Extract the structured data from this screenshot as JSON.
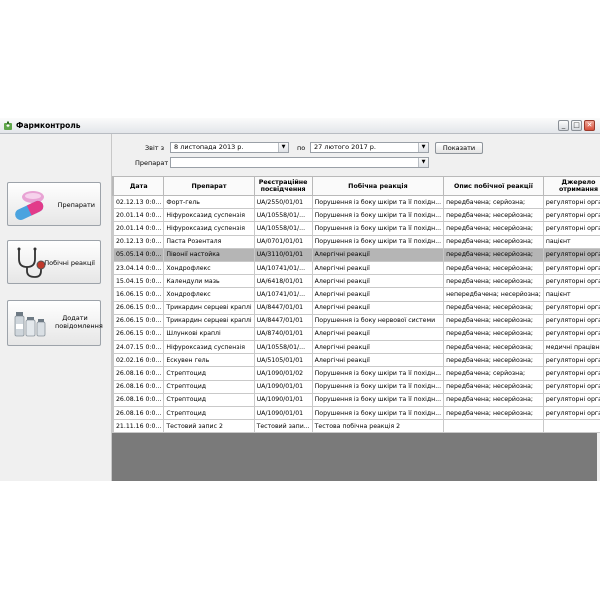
{
  "window": {
    "title": "Фармконтроль",
    "controls": {
      "minimize": "_",
      "maximize": "□",
      "close": "✕"
    }
  },
  "sidebar": {
    "items": [
      {
        "label": "Препарати",
        "icon": "pills-icon"
      },
      {
        "label": "Побічні реакції",
        "icon": "stethoscope-icon"
      },
      {
        "label": "Додати повідомлення",
        "icon": "medicine-bottles-icon"
      }
    ]
  },
  "filter": {
    "report_from_label": "Звіт з",
    "date_from": "8 листопада 2013 р.",
    "to_label": "по",
    "date_to": "27   лютого   2017 р.",
    "drug_label": "Препарат",
    "drug_value": "",
    "show_button": "Показати"
  },
  "table": {
    "columns": [
      "Дата",
      "Препарат",
      "Реєстраційне посвідчення",
      "Побічна реакція",
      "Опис побічної реакції",
      "Джерело отримання"
    ],
    "selected_row": 4,
    "rows": [
      [
        "02.12.13 0:0...",
        "Форт-гель",
        "UA/2550/01/01",
        "Порушення із боку шкіри та її похідн...",
        "передбачена; серйозна;",
        "регуляторні органи"
      ],
      [
        "20.01.14 0:0...",
        "Ніфуроксазид суспензія",
        "UA/10558/01/...",
        "Порушення із боку шкіри та її похідн...",
        "передбачена; несерйозна;",
        "регуляторні органи"
      ],
      [
        "20.01.14 0:0...",
        "Ніфуроксазид суспензія",
        "UA/10558/01/...",
        "Порушення із боку шкіри та її похідн...",
        "передбачена; несерйозна;",
        "регуляторні органи"
      ],
      [
        "20.12.13 0:0...",
        "Паста Розенталя",
        "UA/0701/01/01",
        "Порушення із боку шкіри та її похідн...",
        "передбачена; несерйозна;",
        "пацієнт"
      ],
      [
        "05.05.14 0:0...",
        "Півонії настойка",
        "UA/3110/01/01",
        "Алергічні реакції",
        "передбачена; несерйозна;",
        "регуляторні органи"
      ],
      [
        "23.04.14 0:0...",
        "Хондрофлекс",
        "UA/10741/01/...",
        "Алергічні реакції",
        "передбачена; несерйозна;",
        "регуляторні органи"
      ],
      [
        "15.04.15 0:0...",
        "Календули мазь",
        "UA/6418/01/01",
        "Алергічні реакції",
        "передбачена; несерйозна;",
        "регуляторні органи"
      ],
      [
        "16.06.15 0:0...",
        "Хондрофлекс",
        "UA/10741/01/...",
        "Алергічні реакції",
        "непередбачена; несерйозна;",
        "пацієнт"
      ],
      [
        "26.06.15 0:0...",
        "Трикардин серцеві краплі",
        "UA/8447/01/01",
        "Алергічні реакції",
        "передбачена; несерйозна;",
        "регуляторні органи"
      ],
      [
        "26.06.15 0:0...",
        "Трикардин серцеві краплі",
        "UA/8447/01/01",
        "Порушення із боку нервової системи",
        "передбачена; несерйозна;",
        "регуляторні органи"
      ],
      [
        "26.06.15 0:0...",
        "Шлункові краплі",
        "UA/8740/01/01",
        "Алергічні реакції",
        "передбачена; несерйозна;",
        "регуляторні органи"
      ],
      [
        "24.07.15 0:0...",
        "Ніфуроксазид суспензія",
        "UA/10558/01/...",
        "Алергічні реакції",
        "передбачена; несерйозна;",
        "медичні працівники"
      ],
      [
        "02.02.16 0:0...",
        "Ескувен гель",
        "UA/5105/01/01",
        "Алергічні реакції",
        "передбачена; несерйозна;",
        "регуляторні органи"
      ],
      [
        "26.08.16 0:0...",
        "Стрептоцид",
        "UA/1090/01/02",
        "Порушення із боку шкіри та її похідн...",
        "передбачена; серйозна;",
        "регуляторні органи"
      ],
      [
        "26.08.16 0:0...",
        "Стрептоцид",
        "UA/1090/01/01",
        "Порушення із боку шкіри та її похідн...",
        "передбачена; несерйозна;",
        "регуляторні органи"
      ],
      [
        "26.08.16 0:0...",
        "Стрептоцид",
        "UA/1090/01/01",
        "Порушення із боку шкіри та її похідн...",
        "передбачена; несерйозна;",
        "регуляторні органи"
      ],
      [
        "26.08.16 0:0...",
        "Стрептоцид",
        "UA/1090/01/01",
        "Порушення із боку шкіри та її похідн...",
        "передбачена; несерйозна;",
        "регуляторні органи"
      ],
      [
        "21.11.16 0:0...",
        "Тестовий запис 2",
        "Тестовий запи...",
        "Тестова побічна реакція 2",
        "",
        ""
      ]
    ]
  },
  "colors": {
    "selected_row": "#b5b5b5",
    "grid_background": "#7a7a7a",
    "window_background": "#f0f0f0"
  }
}
